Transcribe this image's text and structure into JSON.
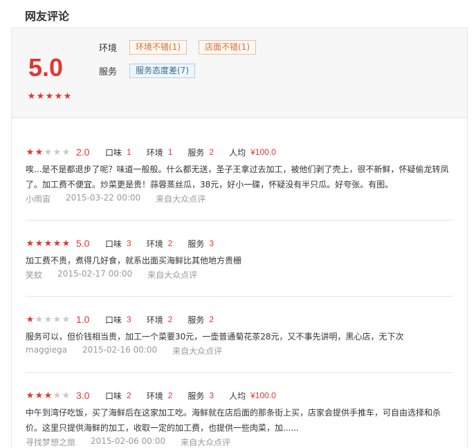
{
  "page_title": "网友评论",
  "summary": {
    "score": "5.0",
    "stars": 5,
    "env_label": "环境",
    "env_tags": [
      "环境不错(1)",
      "店面不错(1)"
    ],
    "service_label": "服务",
    "service_tags": [
      "服务态度差(7)"
    ]
  },
  "reviews": [
    {
      "stars": 2,
      "score": "2.0",
      "taste_label": "口味",
      "taste": "1",
      "env_label": "环境",
      "env": "1",
      "service_label": "服务",
      "service": "2",
      "avg_label": "人均",
      "avg": "¥100.0",
      "text": "唉...是不是都退步了呢？味道一般般。什么都无送，圣子王拿过去加工，被他们剥了壳上，很不新鲜，怀疑偷龙转凤了。加工费不便宜。炒菜更是贵！蒜蓉蒸丝瓜，38元，好小一碟，怀疑没有半只瓜。好夸张。有图。",
      "user": "小雨宙",
      "date": "2015-03-22 00:00",
      "source": "来自大众点评"
    },
    {
      "stars": 5,
      "score": "5.0",
      "taste_label": "口味",
      "taste": "3",
      "env_label": "环境",
      "env": "2",
      "service_label": "服务",
      "service": "3",
      "text": "加工费不贵，煮得几好食，就系出面买海鲜比其他地方贵栅",
      "user": "笑蚊",
      "date": "2015-02-17 00:00",
      "source": "来自大众点评"
    },
    {
      "stars": 1,
      "score": "1.0",
      "taste_label": "口味",
      "taste": "3",
      "env_label": "环境",
      "env": "2",
      "service_label": "服务",
      "service": "2",
      "text": "服务可以，但价钱相当贵，加工一个菜要30元，一壶普通菊花茶28元，又不事先讲明，黑心店，无下次",
      "user": "maggiega",
      "date": "2015-02-16 00:00",
      "source": "来自大众点评"
    },
    {
      "stars": 3,
      "score": "3.0",
      "taste_label": "口味",
      "taste": "2",
      "env_label": "环境",
      "env": "2",
      "service_label": "服务",
      "service": "3",
      "avg_label": "人均",
      "avg": "¥100.0",
      "text": "中午到湾仔吃饭，买了海鲜后在这家加工吃。海鲜就在店后面的那条街上买，店家会提供手推车，可自由选择和杀价。这里只提供海鲜的加工，收取一定的加工费，也提供一些肉菜，加......",
      "user": "寻找梦想之旅",
      "date": "2015-02-06 00:00",
      "source": "来自大众点评"
    }
  ],
  "colors": {
    "accent": "#e4352e",
    "muted": "#999999",
    "tag_pos": "#e06a2c",
    "tag_neg": "#3b6b86"
  }
}
